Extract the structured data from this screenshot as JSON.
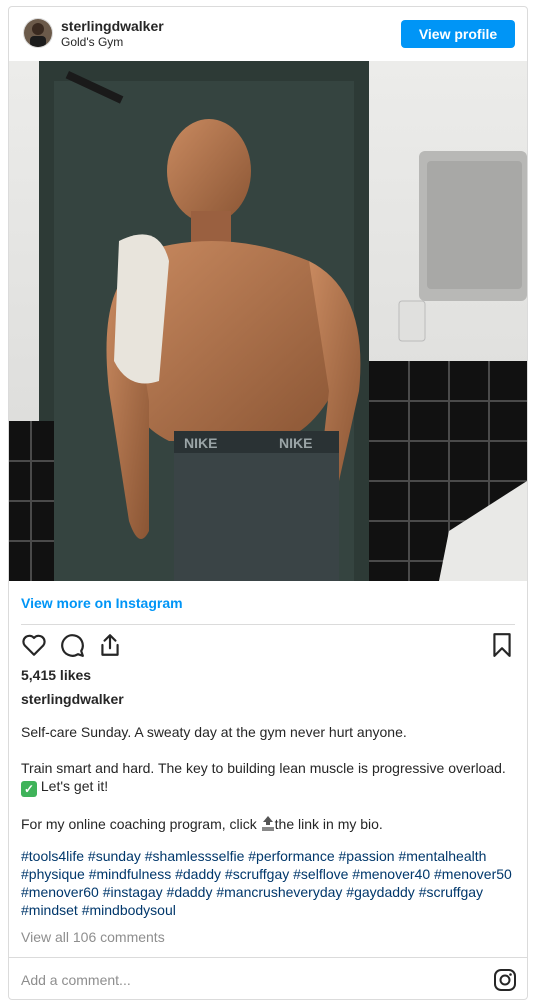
{
  "header": {
    "username": "sterlingdwalker",
    "location": "Gold's Gym",
    "view_profile_label": "View profile"
  },
  "post": {
    "view_more_label": "View more on Instagram",
    "likes": "5,415 likes",
    "author": "sterlingdwalker",
    "caption_line1": "Self-care Sunday. A sweaty day at the gym never hurt anyone.",
    "caption_line2a": "Train smart and hard. The key to building lean muscle is progressive overload.",
    "caption_line2b": "Let's get it!",
    "caption_line3a": "For my online coaching program, click",
    "caption_line3b": "the link in my bio.",
    "hashtags": "#tools4life #sunday #shamlessselfie #performance #passion #mentalhealth #physique #mindfulness #daddy #scruffgay #selflove #menover40 #menover50 #menover60 #instagay #daddy #mancrusheveryday #gaydaddy #scruffgay #mindset #mindbodysoul",
    "comments_label": "View all 106 comments",
    "add_comment_placeholder": "Add a comment..."
  },
  "colors": {
    "accent": "#0095f6",
    "hashtag": "#00376b",
    "muted": "#8e8e8e",
    "border": "#dbdbdb"
  },
  "icons": [
    "heart-icon",
    "comment-icon",
    "share-icon",
    "bookmark-icon",
    "instagram-icon",
    "check-emoji",
    "top-arrow-emoji"
  ]
}
